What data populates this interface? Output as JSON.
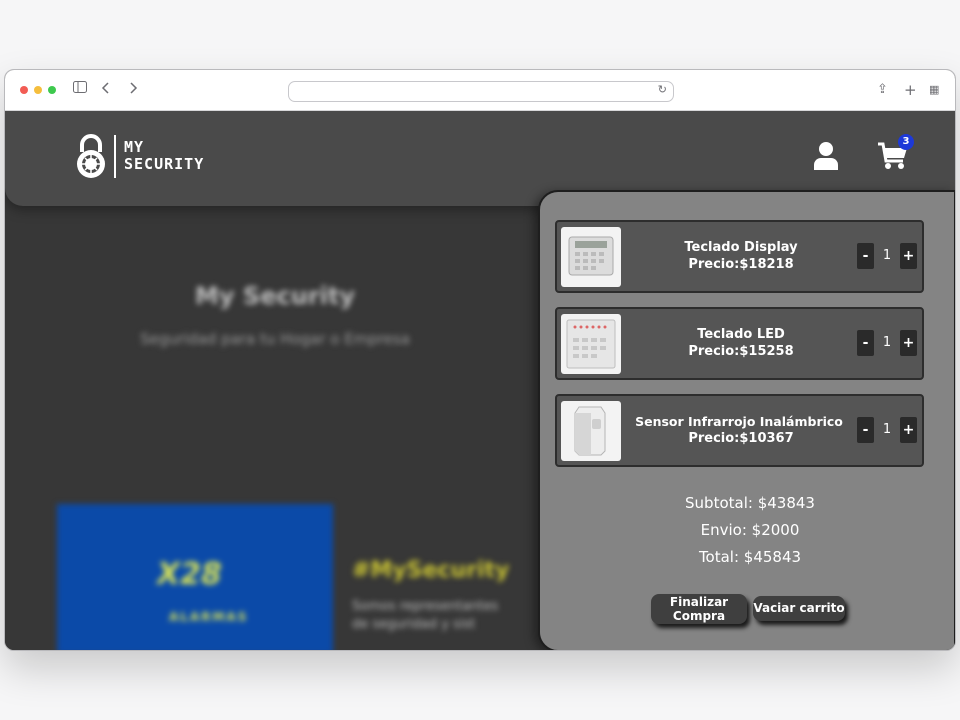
{
  "browser": {
    "back_icon": "chevron-left-icon",
    "forward_icon": "chevron-right-icon",
    "reload_glyph": "↻",
    "plus_glyph": "+",
    "share_glyph": "⇪",
    "tabs_glyph": "▦"
  },
  "header": {
    "logo_line1": "MY",
    "logo_line2": "SECURITY",
    "cart_count": "3"
  },
  "hero": {
    "title": "My Security",
    "subtitle": "Seguridad para tu Hogar o Empresa",
    "brand_logo": "X28",
    "brand_sub": "ALARMAS",
    "hashtag": "#MySecurity",
    "text": "Somos representantes\nde seguridad y sist"
  },
  "cart": {
    "items": [
      {
        "name": "Teclado Display",
        "price": "Precio:$18218",
        "qty": "1",
        "minus": "-",
        "plus": "+"
      },
      {
        "name": "Teclado LED",
        "price": "Precio:$15258",
        "qty": "1",
        "minus": "-",
        "plus": "+"
      },
      {
        "name": "Sensor Infrarrojo Inalámbrico",
        "price": "Precio:$10367",
        "qty": "1",
        "minus": "-",
        "plus": "+"
      }
    ],
    "subtotal": "Subtotal: $43843",
    "shipping": "Envio: $2000",
    "total": "Total: $45843",
    "checkout_line1": "Finalizar",
    "checkout_line2": "Compra",
    "clear_label": "Vaciar carrito"
  },
  "colors": {
    "header_bg": "#4a4a4a",
    "page_bg": "#373737",
    "panel_bg": "#848484",
    "badge": "#1d39d8"
  }
}
